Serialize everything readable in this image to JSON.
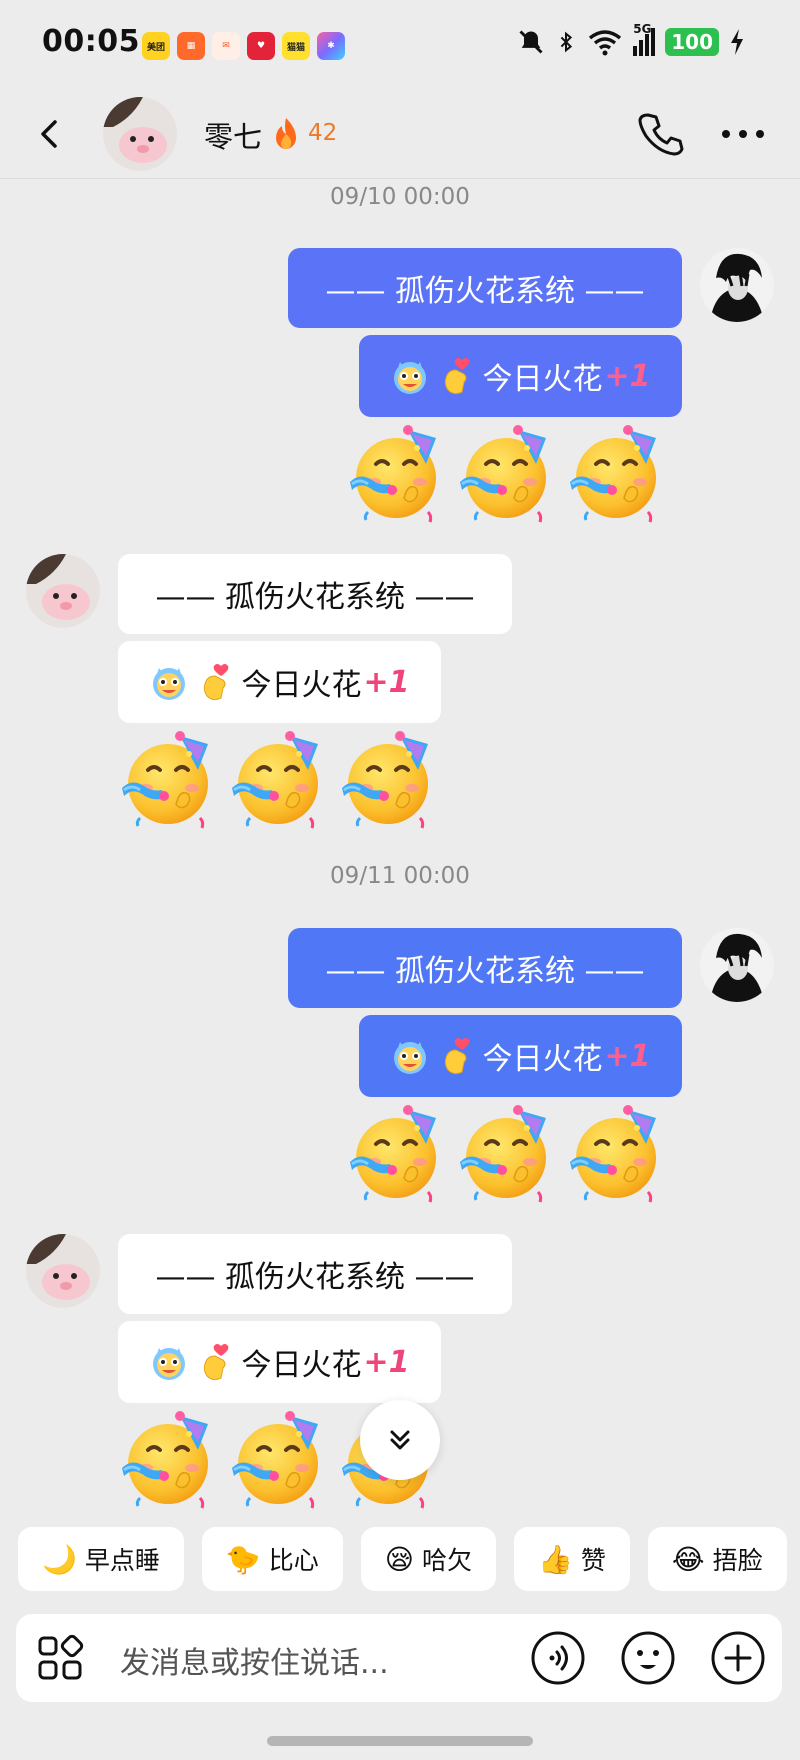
{
  "status_bar": {
    "time": "00:05",
    "battery": "100",
    "network": "5G",
    "app_icons": [
      "美团",
      "",
      "",
      "",
      "猫猫",
      ""
    ]
  },
  "header": {
    "back_icon": "chevron-left-icon",
    "contact_name": "零七",
    "streak_icon": "fire-icon",
    "streak_count": "42",
    "call_icon": "phone-icon",
    "more_icon": "more-dots-icon"
  },
  "conversation": [
    {
      "timestamp": "09/10 00:00",
      "sent": {
        "title_msg": "—— 孤伤火花系统 ——",
        "spark_text": "今日火花",
        "plus_one": "+1",
        "emoji_count": 3,
        "emoji_name": "partying-face"
      },
      "received": {
        "title_msg": "—— 孤伤火花系统 ——",
        "spark_text": "今日火花",
        "plus_one": "+1",
        "emoji_count": 3,
        "emoji_name": "partying-face"
      }
    },
    {
      "timestamp": "09/11 00:00",
      "sent": {
        "title_msg": "—— 孤伤火花系统 ——",
        "spark_text": "今日火花",
        "plus_one": "+1",
        "emoji_count": 3,
        "emoji_name": "partying-face"
      },
      "received": {
        "title_msg": "—— 孤伤火花系统 ——",
        "spark_text": "今日火花",
        "plus_one": "+1",
        "emoji_count": 3,
        "emoji_name": "partying-face"
      }
    }
  ],
  "quick_replies": [
    {
      "emoji": "🌙",
      "label": "早点睡"
    },
    {
      "emoji": "🐤",
      "label": "比心"
    },
    {
      "emoji": "😪",
      "label": "哈欠"
    },
    {
      "emoji": "👍",
      "label": "赞"
    },
    {
      "emoji": "😂",
      "label": "捂脸"
    }
  ],
  "input": {
    "placeholder": "发消息或按住说话...",
    "apps_icon": "apps-grid-icon",
    "voice_icon": "voice-icon",
    "emoji_icon": "emoji-icon",
    "plus_icon": "plus-icon"
  },
  "colors": {
    "sent_bubble": "#5b73f7",
    "received_bubble": "#ffffff",
    "plus_one": "#f0457a",
    "streak": "#ec7a2a"
  }
}
